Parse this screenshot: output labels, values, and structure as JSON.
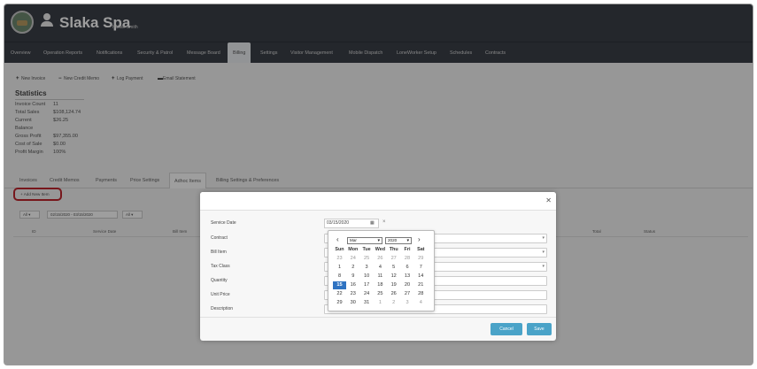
{
  "header": {
    "spa_name": "Slaka Spa",
    "user_name": "Hakan Smith"
  },
  "nav": {
    "tabs": [
      "Overview",
      "Operation Reports",
      "Notifications",
      "Security & Patrol",
      "Message Board",
      "Billing",
      "Settings",
      "Visitor Management",
      "Mobile Dispatch",
      "LoneWorker Setup",
      "Schedules",
      "Contracts"
    ],
    "active": "Billing"
  },
  "actions": [
    "New Invoice",
    "New Credit Memo",
    "Log Payment",
    "Email Statement"
  ],
  "statistics": {
    "title": "Statistics",
    "rows": [
      {
        "label": "Invoice Count",
        "value": "11"
      },
      {
        "label": "Total Sales",
        "value": "$108,124.74"
      },
      {
        "label": "Current",
        "value": "$26.25"
      },
      {
        "label": "Balance",
        "value": ""
      },
      {
        "label": "Gross Profit",
        "value": "$97,355.00"
      },
      {
        "label": "Cost of Sale",
        "value": "$0.00"
      },
      {
        "label": "Profit Margin",
        "value": "100%"
      }
    ]
  },
  "sub_tabs": [
    "Invoices",
    "Credit Memos",
    "Payments",
    "Price Settings",
    "Adhoc Items",
    "Billing Settings & Preferences"
  ],
  "add_new_item": "Add New Item",
  "filters": {
    "all_1": "All",
    "date_range": "02/15/2020 - 03/15/2020",
    "all_2": "All"
  },
  "columns": [
    "ID",
    "Service Date",
    "Bill Item",
    "Total",
    "Status"
  ],
  "modal": {
    "labels": [
      "Service Date",
      "Contract",
      "Bill Item",
      "Tax Class",
      "Quantity",
      "Unit Price",
      "Description"
    ],
    "service_date": "03/15/2020",
    "cancel": "Cancel",
    "save": "Save"
  },
  "datepicker": {
    "month": "Mar",
    "year": "2020",
    "weekdays": [
      "Sun",
      "Mon",
      "Tue",
      "Wed",
      "Thu",
      "Fri",
      "Sat"
    ],
    "weeks": [
      [
        "23",
        "24",
        "25",
        "26",
        "27",
        "28",
        "29"
      ],
      [
        "1",
        "2",
        "3",
        "4",
        "5",
        "6",
        "7"
      ],
      [
        "8",
        "9",
        "10",
        "11",
        "12",
        "13",
        "14"
      ],
      [
        "15",
        "16",
        "17",
        "18",
        "19",
        "20",
        "21"
      ],
      [
        "22",
        "23",
        "24",
        "25",
        "26",
        "27",
        "28"
      ],
      [
        "29",
        "30",
        "31",
        "1",
        "2",
        "3",
        "4"
      ]
    ],
    "selected": "15"
  },
  "colors": {
    "header_bg": "#3a3f48",
    "accent_blue": "#4aa3c8",
    "selected_day": "#2f73c2",
    "highlight_red": "#c0262e"
  }
}
